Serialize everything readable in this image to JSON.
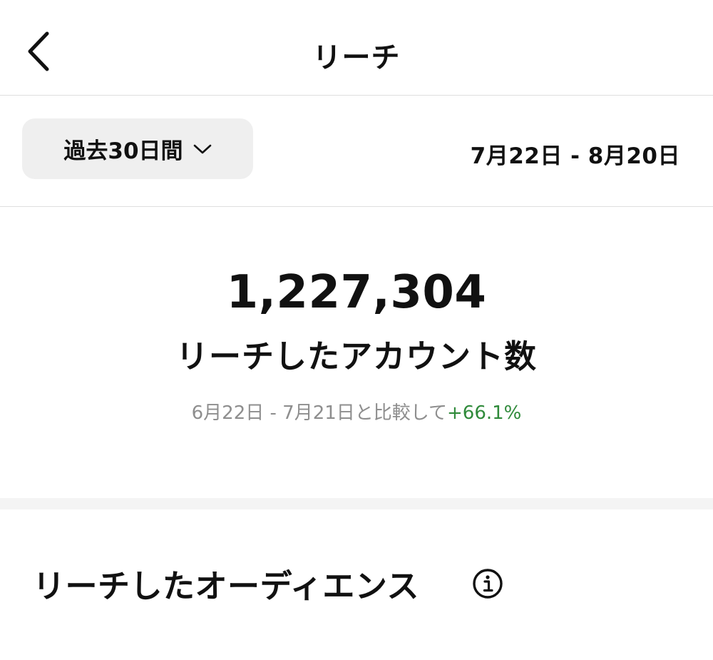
{
  "header": {
    "title": "リーチ",
    "back_icon": "chevron-left-icon"
  },
  "filter": {
    "period_label": "過去30日間",
    "period_icon": "chevron-down-icon",
    "date_range": "7月22日 - 8月20日"
  },
  "metric": {
    "value": "1,227,304",
    "label": "リーチしたアカウント数",
    "compare_text": "6月22日 - 7月21日と比較して",
    "change": "+66.1%",
    "change_color": "#2f8a3a"
  },
  "audience": {
    "title": "リーチしたオーディエンス",
    "info_icon": "info-icon"
  }
}
